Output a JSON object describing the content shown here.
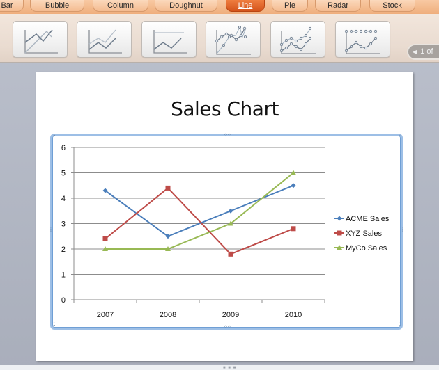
{
  "ribbon": {
    "tabs": [
      {
        "label": "Bar",
        "active": false
      },
      {
        "label": "Bubble",
        "active": false
      },
      {
        "label": "Column",
        "active": false
      },
      {
        "label": "Doughnut",
        "active": false
      },
      {
        "label": "Line",
        "active": true
      },
      {
        "label": "Pie",
        "active": false
      },
      {
        "label": "Radar",
        "active": false
      },
      {
        "label": "Stock",
        "active": false
      }
    ],
    "gallery": {
      "items": [
        {
          "name": "line-style",
          "icon": "line-chart-icon"
        },
        {
          "name": "stacked-line-style",
          "icon": "stacked-line-chart-icon"
        },
        {
          "name": "100-stacked-line-style",
          "icon": "percent-stacked-line-chart-icon"
        },
        {
          "name": "line-with-markers-style",
          "icon": "line-markers-chart-icon"
        },
        {
          "name": "stacked-line-with-markers-style",
          "icon": "stacked-line-markers-chart-icon"
        },
        {
          "name": "100-stacked-line-with-markers-style",
          "icon": "percent-stacked-line-markers-chart-icon"
        }
      ],
      "pager_label": "1 of",
      "pager_icon": "◀"
    }
  },
  "slide": {
    "title": "Sales Chart"
  },
  "chart_data": {
    "type": "line",
    "title": "Sales Chart",
    "xlabel": "",
    "ylabel": "",
    "categories": [
      "2007",
      "2008",
      "2009",
      "2010"
    ],
    "ylim": [
      0,
      6
    ],
    "yticks": [
      "0",
      "1",
      "2",
      "3",
      "4",
      "5",
      "6"
    ],
    "grid": true,
    "legend": "right",
    "series": [
      {
        "name": "ACME Sales",
        "values": [
          4.3,
          2.5,
          3.5,
          4.5
        ],
        "color": "#4a7ebb",
        "marker": "diamond"
      },
      {
        "name": "XYZ Sales",
        "values": [
          2.4,
          4.4,
          1.8,
          2.8
        ],
        "color": "#be4b48",
        "marker": "square"
      },
      {
        "name": "MyCo Sales",
        "values": [
          2.0,
          2.0,
          3.0,
          5.0
        ],
        "color": "#98b954",
        "marker": "triangle"
      }
    ]
  }
}
